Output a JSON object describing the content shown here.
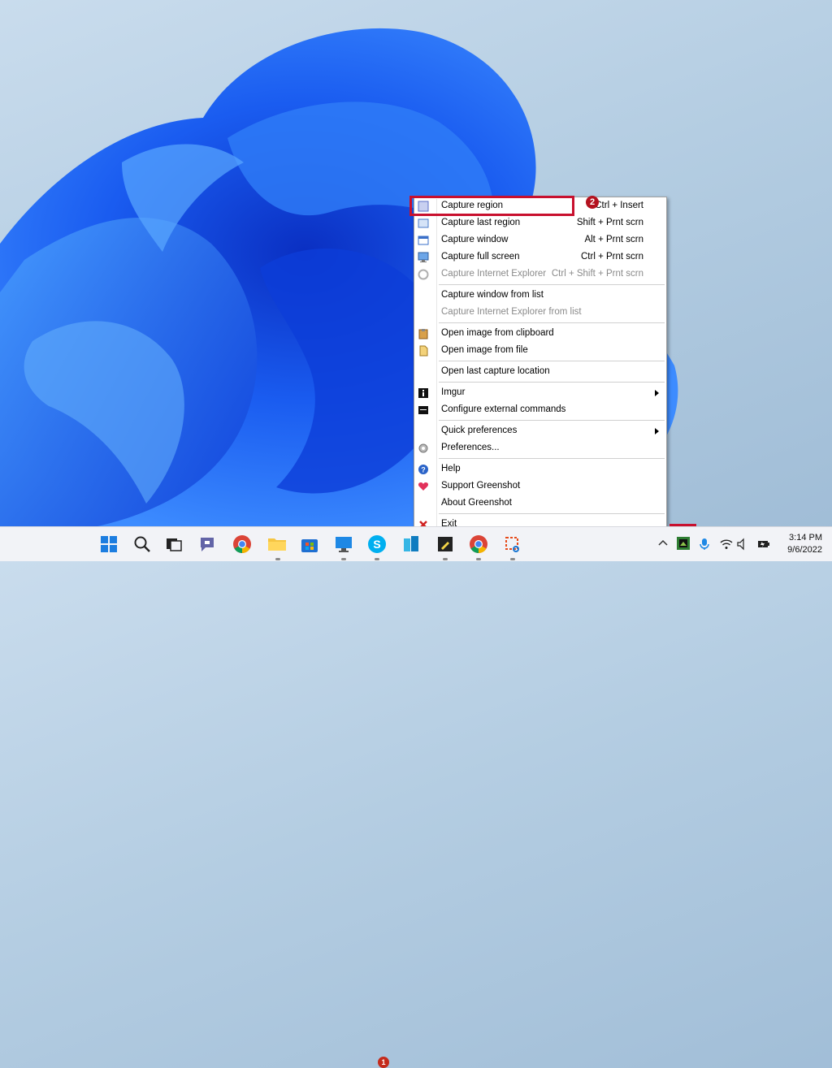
{
  "menu": {
    "items": [
      {
        "label": "Capture region",
        "shortcut": "Ctrl + Insert",
        "icon": "region-icon",
        "disabled": false
      },
      {
        "label": "Capture last region",
        "shortcut": "Shift + Prnt scrn",
        "icon": "last-region-icon",
        "disabled": false
      },
      {
        "label": "Capture window",
        "shortcut": "Alt + Prnt scrn",
        "icon": "window-icon",
        "disabled": false
      },
      {
        "label": "Capture full screen",
        "shortcut": "Ctrl + Prnt scrn",
        "icon": "monitor-icon",
        "disabled": false
      },
      {
        "label": "Capture Internet Explorer",
        "shortcut": "Ctrl + Shift + Prnt scrn",
        "icon": "ie-icon",
        "disabled": true
      },
      {
        "label": "Capture window from list",
        "shortcut": "",
        "disabled": false
      },
      {
        "label": "Capture Internet Explorer from list",
        "shortcut": "",
        "disabled": true
      },
      {
        "label": "Open image from clipboard",
        "icon": "clipboard-icon",
        "disabled": false
      },
      {
        "label": "Open image from file",
        "icon": "file-icon",
        "disabled": false
      },
      {
        "label": "Open last capture location",
        "disabled": false
      },
      {
        "label": "Imgur",
        "icon": "info-icon",
        "submenu": true
      },
      {
        "label": "Configure external commands",
        "icon": "cmd-icon"
      },
      {
        "label": "Quick preferences",
        "submenu": true
      },
      {
        "label": "Preferences...",
        "icon": "gear-icon"
      },
      {
        "label": "Help",
        "icon": "help-icon"
      },
      {
        "label": "Support Greenshot",
        "icon": "heart-icon"
      },
      {
        "label": "About Greenshot"
      },
      {
        "label": "Exit",
        "icon": "close-icon"
      }
    ]
  },
  "annotations": {
    "step1": "1",
    "step2": "2"
  },
  "taskbar": {
    "skype_badge": "1",
    "time": "3:14 PM",
    "date": "9/6/2022"
  },
  "colors": {
    "highlight_box": "#c8102e",
    "menu_bg": "#ffffff",
    "taskbar_bg": "#f2f3f7"
  }
}
